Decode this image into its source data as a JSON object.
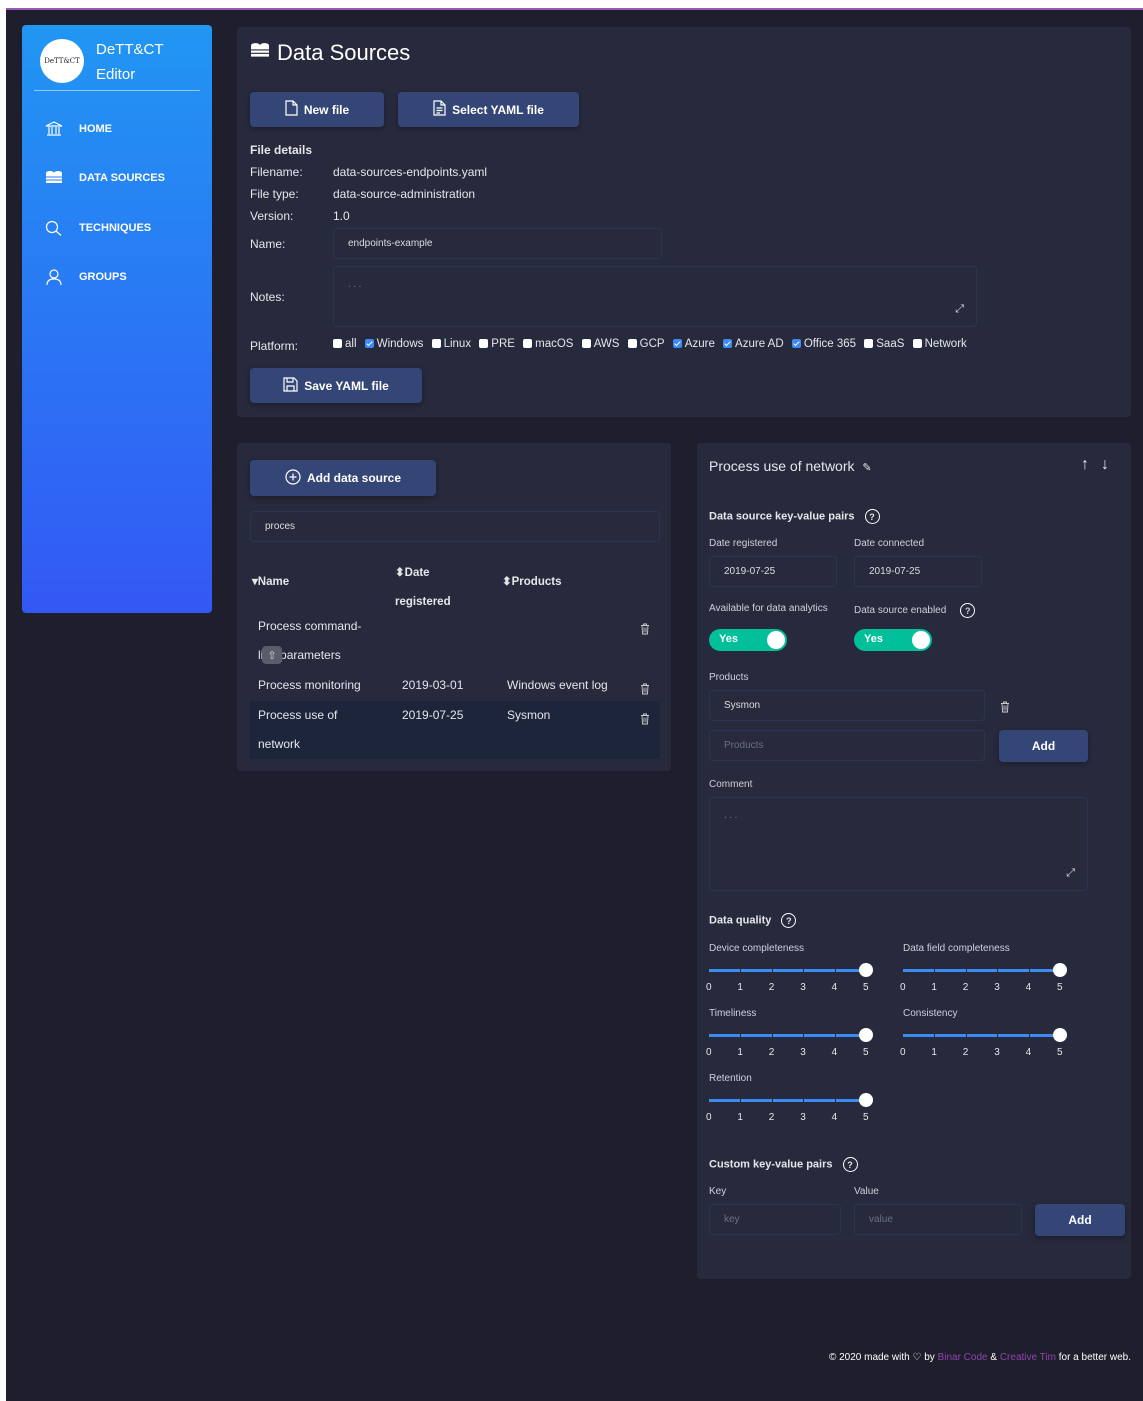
{
  "sidebar": {
    "logo_badge": "DeTT&CT",
    "logo_line1": "DeTT&CT",
    "logo_line2": "Editor",
    "items": [
      {
        "label": "HOME",
        "icon": "bank-icon"
      },
      {
        "label": "DATA SOURCES",
        "icon": "database-icon"
      },
      {
        "label": "TECHNIQUES",
        "icon": "search-icon"
      },
      {
        "label": "GROUPS",
        "icon": "user-icon"
      }
    ]
  },
  "header": {
    "title": "Data Sources",
    "new_file": "New file",
    "select_yaml": "Select YAML file"
  },
  "file_details": {
    "heading": "File details",
    "filename_label": "Filename:",
    "filename": "data-sources-endpoints.yaml",
    "filetype_label": "File type:",
    "filetype": "data-source-administration",
    "version_label": "Version:",
    "version": "1.0",
    "name_label": "Name:",
    "name_value": "endpoints-example",
    "notes_label": "Notes:",
    "notes_placeholder": "...",
    "platform_label": "Platform:",
    "platforms": [
      {
        "label": "all",
        "checked": false
      },
      {
        "label": "Windows",
        "checked": true
      },
      {
        "label": "Linux",
        "checked": false
      },
      {
        "label": "PRE",
        "checked": false
      },
      {
        "label": "macOS",
        "checked": false
      },
      {
        "label": "AWS",
        "checked": false
      },
      {
        "label": "GCP",
        "checked": false
      },
      {
        "label": "Azure",
        "checked": true
      },
      {
        "label": "Azure AD",
        "checked": true
      },
      {
        "label": "Office 365",
        "checked": true
      },
      {
        "label": "SaaS",
        "checked": false
      },
      {
        "label": "Network",
        "checked": false
      }
    ],
    "save_yaml": "Save YAML file"
  },
  "list": {
    "add_button": "Add data source",
    "search_value": "proces",
    "col_name": "Name",
    "col_date_1": "Date",
    "col_date_2": "registered",
    "col_products": "Products",
    "rows": [
      {
        "name_1": "Process command-",
        "name_2": "line parameters",
        "date": "",
        "products": ""
      },
      {
        "name_1": "Process monitoring",
        "name_2": "",
        "date": "2019-03-01",
        "products": "Windows event log"
      },
      {
        "name_1": "Process use of",
        "name_2": "network",
        "date": "2019-07-25",
        "products": "Sysmon"
      }
    ]
  },
  "detail": {
    "title": "Process use of network",
    "kv_heading": "Data source key-value pairs",
    "date_registered_label": "Date registered",
    "date_registered": "2019-07-25",
    "date_connected_label": "Date connected",
    "date_connected": "2019-07-25",
    "available_label": "Available for data analytics",
    "enabled_label": "Data source enabled",
    "available_value": "Yes",
    "enabled_value": "Yes",
    "products_label": "Products",
    "product_item": "Sysmon",
    "products_placeholder": "Products",
    "add_label": "Add",
    "comment_label": "Comment",
    "comment_placeholder": "...",
    "dq_heading": "Data quality",
    "scale": [
      "0",
      "1",
      "2",
      "3",
      "4",
      "5"
    ],
    "sliders": [
      {
        "label": "Device completeness",
        "value": 5
      },
      {
        "label": "Data field completeness",
        "value": 5
      },
      {
        "label": "Timeliness",
        "value": 5
      },
      {
        "label": "Consistency",
        "value": 5
      },
      {
        "label": "Retention",
        "value": 5
      }
    ],
    "custom_heading": "Custom key-value pairs",
    "key_label": "Key",
    "value_label": "Value",
    "key_placeholder": "key",
    "value_placeholder": "value",
    "custom_add": "Add"
  },
  "footer": {
    "prefix": "© 2020 made with",
    "by": "by",
    "link1": "Binar Code",
    "amp": "&",
    "link2": "Creative Tim",
    "suffix": "for a better web."
  },
  "colors": {
    "accent": "#344675",
    "sidebar_top": "#2196f3",
    "sidebar_bottom": "#3358f4",
    "toggle": "#00bf9a",
    "link": "#8e44ad"
  }
}
